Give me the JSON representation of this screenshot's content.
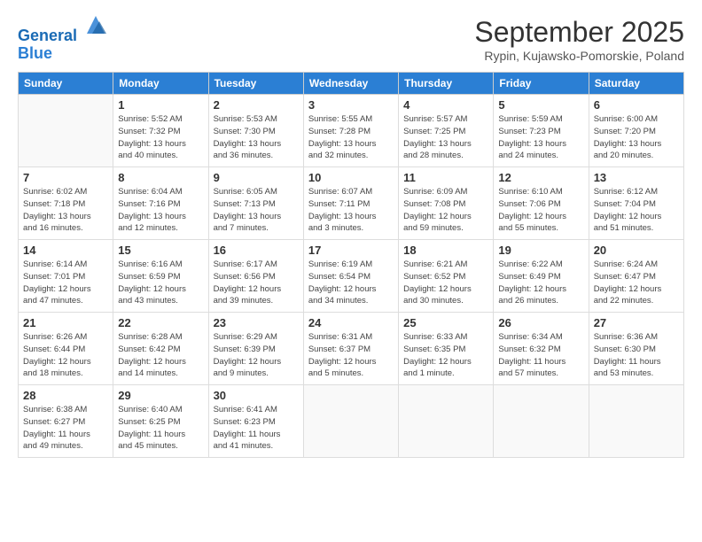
{
  "header": {
    "logo_line1": "General",
    "logo_line2": "Blue",
    "month": "September 2025",
    "location": "Rypin, Kujawsko-Pomorskie, Poland"
  },
  "weekdays": [
    "Sunday",
    "Monday",
    "Tuesday",
    "Wednesday",
    "Thursday",
    "Friday",
    "Saturday"
  ],
  "weeks": [
    [
      {
        "day": "",
        "info": ""
      },
      {
        "day": "1",
        "info": "Sunrise: 5:52 AM\nSunset: 7:32 PM\nDaylight: 13 hours\nand 40 minutes."
      },
      {
        "day": "2",
        "info": "Sunrise: 5:53 AM\nSunset: 7:30 PM\nDaylight: 13 hours\nand 36 minutes."
      },
      {
        "day": "3",
        "info": "Sunrise: 5:55 AM\nSunset: 7:28 PM\nDaylight: 13 hours\nand 32 minutes."
      },
      {
        "day": "4",
        "info": "Sunrise: 5:57 AM\nSunset: 7:25 PM\nDaylight: 13 hours\nand 28 minutes."
      },
      {
        "day": "5",
        "info": "Sunrise: 5:59 AM\nSunset: 7:23 PM\nDaylight: 13 hours\nand 24 minutes."
      },
      {
        "day": "6",
        "info": "Sunrise: 6:00 AM\nSunset: 7:20 PM\nDaylight: 13 hours\nand 20 minutes."
      }
    ],
    [
      {
        "day": "7",
        "info": "Sunrise: 6:02 AM\nSunset: 7:18 PM\nDaylight: 13 hours\nand 16 minutes."
      },
      {
        "day": "8",
        "info": "Sunrise: 6:04 AM\nSunset: 7:16 PM\nDaylight: 13 hours\nand 12 minutes."
      },
      {
        "day": "9",
        "info": "Sunrise: 6:05 AM\nSunset: 7:13 PM\nDaylight: 13 hours\nand 7 minutes."
      },
      {
        "day": "10",
        "info": "Sunrise: 6:07 AM\nSunset: 7:11 PM\nDaylight: 13 hours\nand 3 minutes."
      },
      {
        "day": "11",
        "info": "Sunrise: 6:09 AM\nSunset: 7:08 PM\nDaylight: 12 hours\nand 59 minutes."
      },
      {
        "day": "12",
        "info": "Sunrise: 6:10 AM\nSunset: 7:06 PM\nDaylight: 12 hours\nand 55 minutes."
      },
      {
        "day": "13",
        "info": "Sunrise: 6:12 AM\nSunset: 7:04 PM\nDaylight: 12 hours\nand 51 minutes."
      }
    ],
    [
      {
        "day": "14",
        "info": "Sunrise: 6:14 AM\nSunset: 7:01 PM\nDaylight: 12 hours\nand 47 minutes."
      },
      {
        "day": "15",
        "info": "Sunrise: 6:16 AM\nSunset: 6:59 PM\nDaylight: 12 hours\nand 43 minutes."
      },
      {
        "day": "16",
        "info": "Sunrise: 6:17 AM\nSunset: 6:56 PM\nDaylight: 12 hours\nand 39 minutes."
      },
      {
        "day": "17",
        "info": "Sunrise: 6:19 AM\nSunset: 6:54 PM\nDaylight: 12 hours\nand 34 minutes."
      },
      {
        "day": "18",
        "info": "Sunrise: 6:21 AM\nSunset: 6:52 PM\nDaylight: 12 hours\nand 30 minutes."
      },
      {
        "day": "19",
        "info": "Sunrise: 6:22 AM\nSunset: 6:49 PM\nDaylight: 12 hours\nand 26 minutes."
      },
      {
        "day": "20",
        "info": "Sunrise: 6:24 AM\nSunset: 6:47 PM\nDaylight: 12 hours\nand 22 minutes."
      }
    ],
    [
      {
        "day": "21",
        "info": "Sunrise: 6:26 AM\nSunset: 6:44 PM\nDaylight: 12 hours\nand 18 minutes."
      },
      {
        "day": "22",
        "info": "Sunrise: 6:28 AM\nSunset: 6:42 PM\nDaylight: 12 hours\nand 14 minutes."
      },
      {
        "day": "23",
        "info": "Sunrise: 6:29 AM\nSunset: 6:39 PM\nDaylight: 12 hours\nand 9 minutes."
      },
      {
        "day": "24",
        "info": "Sunrise: 6:31 AM\nSunset: 6:37 PM\nDaylight: 12 hours\nand 5 minutes."
      },
      {
        "day": "25",
        "info": "Sunrise: 6:33 AM\nSunset: 6:35 PM\nDaylight: 12 hours\nand 1 minute."
      },
      {
        "day": "26",
        "info": "Sunrise: 6:34 AM\nSunset: 6:32 PM\nDaylight: 11 hours\nand 57 minutes."
      },
      {
        "day": "27",
        "info": "Sunrise: 6:36 AM\nSunset: 6:30 PM\nDaylight: 11 hours\nand 53 minutes."
      }
    ],
    [
      {
        "day": "28",
        "info": "Sunrise: 6:38 AM\nSunset: 6:27 PM\nDaylight: 11 hours\nand 49 minutes."
      },
      {
        "day": "29",
        "info": "Sunrise: 6:40 AM\nSunset: 6:25 PM\nDaylight: 11 hours\nand 45 minutes."
      },
      {
        "day": "30",
        "info": "Sunrise: 6:41 AM\nSunset: 6:23 PM\nDaylight: 11 hours\nand 41 minutes."
      },
      {
        "day": "",
        "info": ""
      },
      {
        "day": "",
        "info": ""
      },
      {
        "day": "",
        "info": ""
      },
      {
        "day": "",
        "info": ""
      }
    ]
  ]
}
